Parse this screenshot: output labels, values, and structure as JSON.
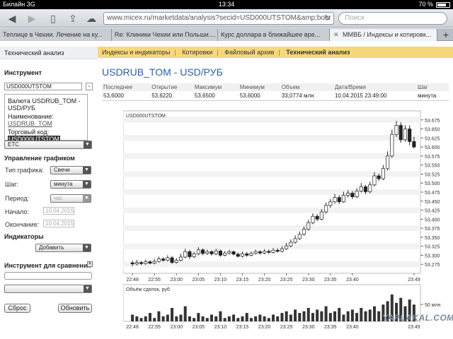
{
  "status": {
    "carrier": "Билайн  3G",
    "time": "13:34",
    "battery": "70 %"
  },
  "browser": {
    "url": "www.micex.ru/marketdata/analysis?secid=USD000UTSTOM&amp;boar",
    "search_placeholder": "Поиск",
    "tabs": [
      "Теплице в Чехии. Лечение на ку...",
      "Re: Клиники Чехии или Польши....",
      "Курс доллара в ближайшее вре...",
      "ММВБ / Индексы и котировк..."
    ]
  },
  "sidebar": {
    "header": "Технический анализ",
    "instrument_label": "Инструмент",
    "instrument_value": "USD000UTSTOM",
    "info_name": "Валюта USDRUB_TOM - USD/РУБ",
    "info_short_label": "Наименование:",
    "info_short_value": "USDRUB_TOM",
    "info_code_label": "Торговый код:",
    "info_code_value": "USD000UTSTOM",
    "board": "ETC",
    "chart_mgmt": "Управление графиком",
    "chart_type_label": "Тип графика:",
    "chart_type": "Свечи",
    "step_label": "Шаг:",
    "step": "минута",
    "period_label": "Период:",
    "period": "час",
    "start_label": "Начало:",
    "start": "10.04.2015",
    "end_label": "Окончание:",
    "end": "10.04.2015",
    "indicators_label": "Индикаторы",
    "add_button": "Добавить",
    "compare_label": "Инструмент для сравнения",
    "reset_button": "Сброс",
    "update_button": "Обновить"
  },
  "nav": {
    "items": [
      "Индексы и индикаторы",
      "Котировки",
      "Файловый архив",
      "Технический анализ"
    ]
  },
  "page": {
    "title": "USDRUB_TOM - USD/РУБ",
    "watermark": "YAPLAKAL.COM"
  },
  "quote": {
    "headers": [
      "Последнее",
      "Открытие",
      "Максимум",
      "Минимум",
      "Объем",
      "Дата/Время",
      "Шаг"
    ],
    "values": [
      "53,6000",
      "53,6220",
      "53,6500",
      "53,6000",
      "33,0774 млн",
      "10.04.2015 23:49:00",
      "минута"
    ]
  },
  "colors": {
    "up": "#ffffff",
    "down": "#222222",
    "nav": "#f6d87a",
    "title": "#2a5fa8"
  },
  "chart_data": {
    "type": "candlestick",
    "title": "USD000UTSTOM",
    "ylim": [
      53.25,
      53.7
    ],
    "yticks": [
      53.275,
      53.3,
      53.325,
      53.35,
      53.375,
      53.4,
      53.425,
      53.45,
      53.475,
      53.5,
      53.525,
      53.55,
      53.575,
      53.6,
      53.625,
      53.65,
      53.675
    ],
    "xticks": [
      "22:48",
      "22:55",
      "23:00",
      "23:05",
      "23:10",
      "23:15",
      "23:20",
      "23:25",
      "23:30",
      "23:35",
      "23:40",
      "23:49"
    ],
    "volume_title": "Объём сделок, руб",
    "volume_tick": "50 млн",
    "candles": [
      [
        53.279,
        53.276,
        53.285,
        53.27
      ],
      [
        53.276,
        53.28,
        53.287,
        53.272
      ],
      [
        53.28,
        53.277,
        53.284,
        53.273
      ],
      [
        53.277,
        53.282,
        53.288,
        53.274
      ],
      [
        53.282,
        53.278,
        53.286,
        53.275
      ],
      [
        53.278,
        53.283,
        53.29,
        53.275
      ],
      [
        53.283,
        53.29,
        53.296,
        53.28
      ],
      [
        53.29,
        53.286,
        53.294,
        53.282
      ],
      [
        53.286,
        53.293,
        53.3,
        53.283
      ],
      [
        53.293,
        53.28,
        53.298,
        53.276
      ],
      [
        53.28,
        53.286,
        53.292,
        53.277
      ],
      [
        53.286,
        53.295,
        53.304,
        53.283
      ],
      [
        53.295,
        53.31,
        53.318,
        53.292
      ],
      [
        53.31,
        53.296,
        53.315,
        53.29
      ],
      [
        53.296,
        53.304,
        53.31,
        53.292
      ],
      [
        53.304,
        53.315,
        53.322,
        53.3
      ],
      [
        53.315,
        53.305,
        53.319,
        53.3
      ],
      [
        53.305,
        53.31,
        53.316,
        53.301
      ],
      [
        53.31,
        53.304,
        53.314,
        53.299
      ],
      [
        53.304,
        53.312,
        53.318,
        53.3
      ],
      [
        53.312,
        53.3,
        53.316,
        53.296
      ],
      [
        53.3,
        53.306,
        53.312,
        53.297
      ],
      [
        53.306,
        53.31,
        53.315,
        53.302
      ],
      [
        53.31,
        53.303,
        53.313,
        53.3
      ],
      [
        53.303,
        53.297,
        53.308,
        53.294
      ],
      [
        53.297,
        53.304,
        53.31,
        53.294
      ],
      [
        53.304,
        53.3,
        53.309,
        53.296
      ],
      [
        53.3,
        53.305,
        53.311,
        53.297
      ],
      [
        53.305,
        53.31,
        53.316,
        53.302
      ],
      [
        53.31,
        53.306,
        53.314,
        53.302
      ],
      [
        53.306,
        53.311,
        53.317,
        53.303
      ],
      [
        53.311,
        53.308,
        53.316,
        53.304
      ],
      [
        53.308,
        53.314,
        53.32,
        53.305
      ],
      [
        53.314,
        53.311,
        53.319,
        53.307
      ],
      [
        53.311,
        53.318,
        53.325,
        53.308
      ],
      [
        53.318,
        53.326,
        53.334,
        53.315
      ],
      [
        53.326,
        53.336,
        53.344,
        53.322
      ],
      [
        53.336,
        53.346,
        53.355,
        53.332
      ],
      [
        53.346,
        53.358,
        53.366,
        53.342
      ],
      [
        53.358,
        53.372,
        53.38,
        53.354
      ],
      [
        53.372,
        53.39,
        53.398,
        53.368
      ],
      [
        53.39,
        53.408,
        53.416,
        53.386
      ],
      [
        53.408,
        53.4,
        53.414,
        53.395
      ],
      [
        53.4,
        53.42,
        53.428,
        53.397
      ],
      [
        53.42,
        53.438,
        53.446,
        53.416
      ],
      [
        53.438,
        53.448,
        53.456,
        53.432
      ],
      [
        53.448,
        53.46,
        53.47,
        53.443
      ],
      [
        53.46,
        53.448,
        53.466,
        53.442
      ],
      [
        53.448,
        53.466,
        53.476,
        53.445
      ],
      [
        53.466,
        53.472,
        53.48,
        53.46
      ],
      [
        53.472,
        53.462,
        53.478,
        53.456
      ],
      [
        53.462,
        53.478,
        53.486,
        53.458
      ],
      [
        53.478,
        53.49,
        53.5,
        53.474
      ],
      [
        53.49,
        53.476,
        53.495,
        53.47
      ],
      [
        53.476,
        53.495,
        53.504,
        53.472
      ],
      [
        53.495,
        53.52,
        53.53,
        53.49
      ],
      [
        53.52,
        53.512,
        53.526,
        53.506
      ],
      [
        53.512,
        53.54,
        53.55,
        53.508
      ],
      [
        53.54,
        53.575,
        53.588,
        53.535
      ],
      [
        53.575,
        53.635,
        53.648,
        53.57
      ],
      [
        53.635,
        53.66,
        53.672,
        53.628
      ],
      [
        53.66,
        53.62,
        53.668,
        53.612
      ],
      [
        53.62,
        53.65,
        53.66,
        53.615
      ],
      [
        53.65,
        53.615,
        53.66,
        53.605
      ],
      [
        53.615,
        53.6,
        53.628,
        53.596
      ]
    ],
    "volumes": [
      4,
      3,
      2,
      3,
      5,
      2,
      6,
      3,
      4,
      8,
      3,
      4,
      9,
      3,
      2,
      5,
      3,
      2,
      4,
      3,
      6,
      2,
      3,
      4,
      2,
      3,
      5,
      2,
      3,
      4,
      3,
      2,
      4,
      3,
      5,
      6,
      4,
      7,
      5,
      6,
      8,
      5,
      7,
      6,
      9,
      5,
      6,
      8,
      4,
      6,
      7,
      5,
      8,
      6,
      7,
      9,
      6,
      10,
      12,
      16,
      11,
      14,
      9,
      13,
      10
    ]
  }
}
